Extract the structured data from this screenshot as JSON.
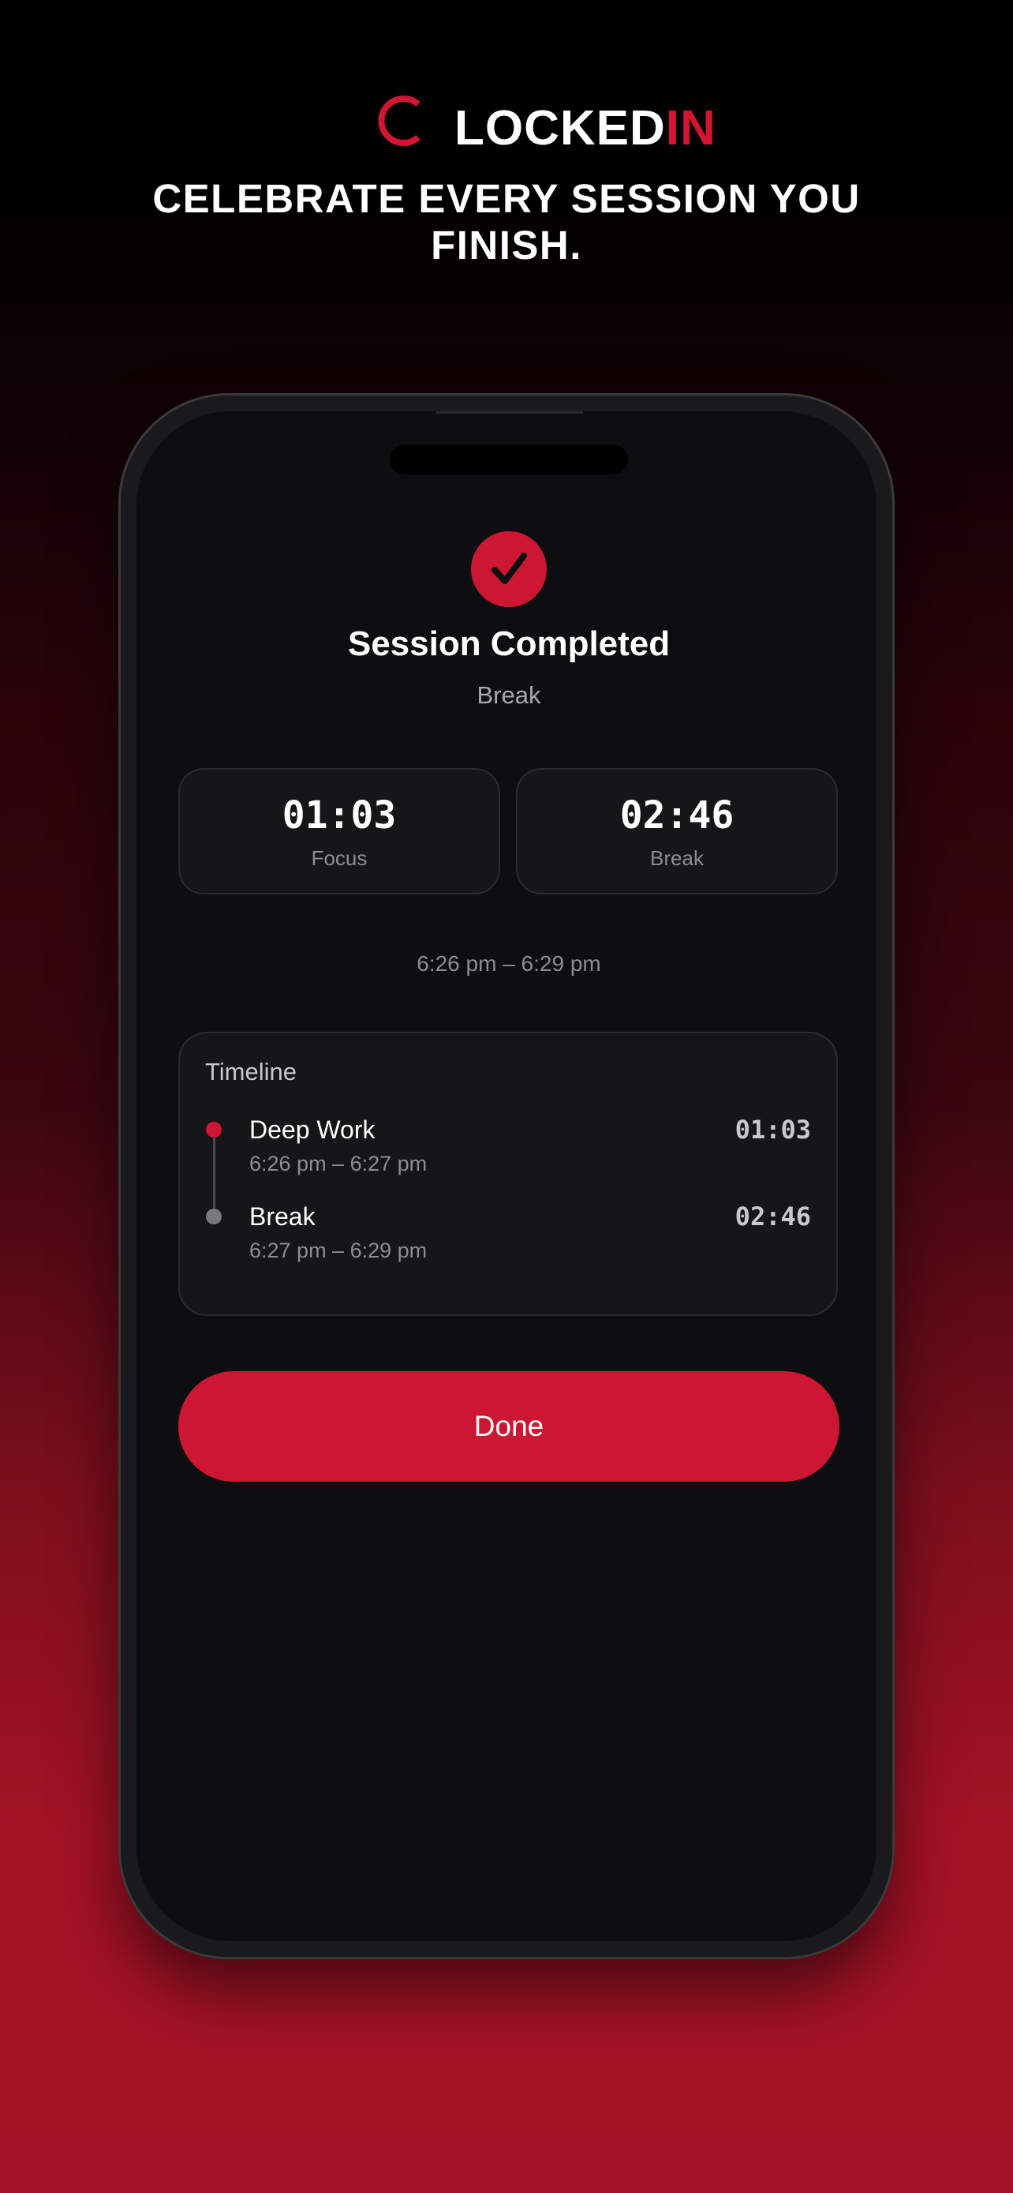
{
  "brand": {
    "name_main": "LOCKED",
    "name_accent": "IN",
    "logo_icon": "ring-logo-icon",
    "accent_color": "#d21532"
  },
  "tagline": "CELEBRATE EVERY SESSION YOU FINISH.",
  "session": {
    "status_icon": "checkmark-icon",
    "title": "Session Completed",
    "subtitle": "Break",
    "stats": [
      {
        "value": "01:03",
        "label": "Focus"
      },
      {
        "value": "02:46",
        "label": "Break"
      }
    ],
    "time_range": "6:26 pm – 6:29 pm"
  },
  "timeline": {
    "title": "Timeline",
    "items": [
      {
        "name": "Deep Work",
        "time": "6:26 pm – 6:27 pm",
        "duration": "01:03",
        "dot_color": "#d21532"
      },
      {
        "name": "Break",
        "time": "6:27 pm – 6:29 pm",
        "duration": "02:46",
        "dot_color": "#7a7a7e"
      }
    ]
  },
  "actions": {
    "done_label": "Done",
    "button_color": "#cc1632"
  }
}
